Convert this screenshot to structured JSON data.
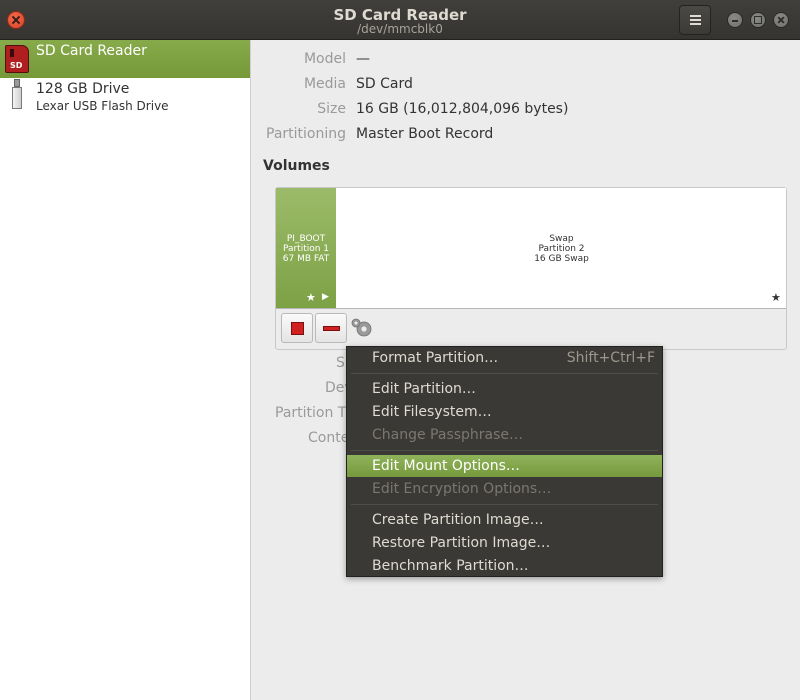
{
  "window": {
    "title": "SD Card Reader",
    "subtitle": "/dev/mmcblk0"
  },
  "sidebar": {
    "devices": [
      {
        "name": "SD Card Reader",
        "desc": "",
        "icon": "sd-card-icon",
        "selected": true,
        "badge": "SD"
      },
      {
        "name": "128 GB Drive",
        "desc": "Lexar USB Flash Drive",
        "icon": "usb-drive-icon",
        "selected": false
      }
    ]
  },
  "details": {
    "model_label": "Model",
    "model_value": "—",
    "media_label": "Media",
    "media_value": "SD Card",
    "size_label": "Size",
    "size_value": "16 GB (16,012,804,096 bytes)",
    "partitioning_label": "Partitioning",
    "partitioning_value": "Master Boot Record"
  },
  "volumes": {
    "heading": "Volumes",
    "partitions": [
      {
        "line1": "PI_BOOT",
        "line2": "Partition 1",
        "line3": "67 MB FAT",
        "selected": true
      },
      {
        "line1": "Swap",
        "line2": "Partition 2",
        "line3": "16 GB Swap",
        "selected": false
      }
    ]
  },
  "obscured_labels": {
    "size_partial": "S",
    "device_partial": "Dev",
    "partition_type_partial": "Partition T",
    "contents_partial": "Conte"
  },
  "context_menu": {
    "items": [
      {
        "label": "Format Partition…",
        "shortcut": "Shift+Ctrl+F",
        "enabled": true
      },
      {
        "label": "Edit Partition…",
        "enabled": true
      },
      {
        "label": "Edit Filesystem…",
        "enabled": true
      },
      {
        "label": "Change Passphrase…",
        "enabled": false
      },
      {
        "label": "Edit Mount Options…",
        "enabled": true,
        "highlighted": true
      },
      {
        "label": "Edit Encryption Options…",
        "enabled": false
      },
      {
        "label": "Create Partition Image…",
        "enabled": true
      },
      {
        "label": "Restore Partition Image…",
        "enabled": true
      },
      {
        "label": "Benchmark Partition…",
        "enabled": true
      }
    ]
  },
  "colors": {
    "accent": "#7fa141",
    "titlebar": "#3c3b37",
    "menu_bg": "#3a3935",
    "danger": "#d12020"
  }
}
